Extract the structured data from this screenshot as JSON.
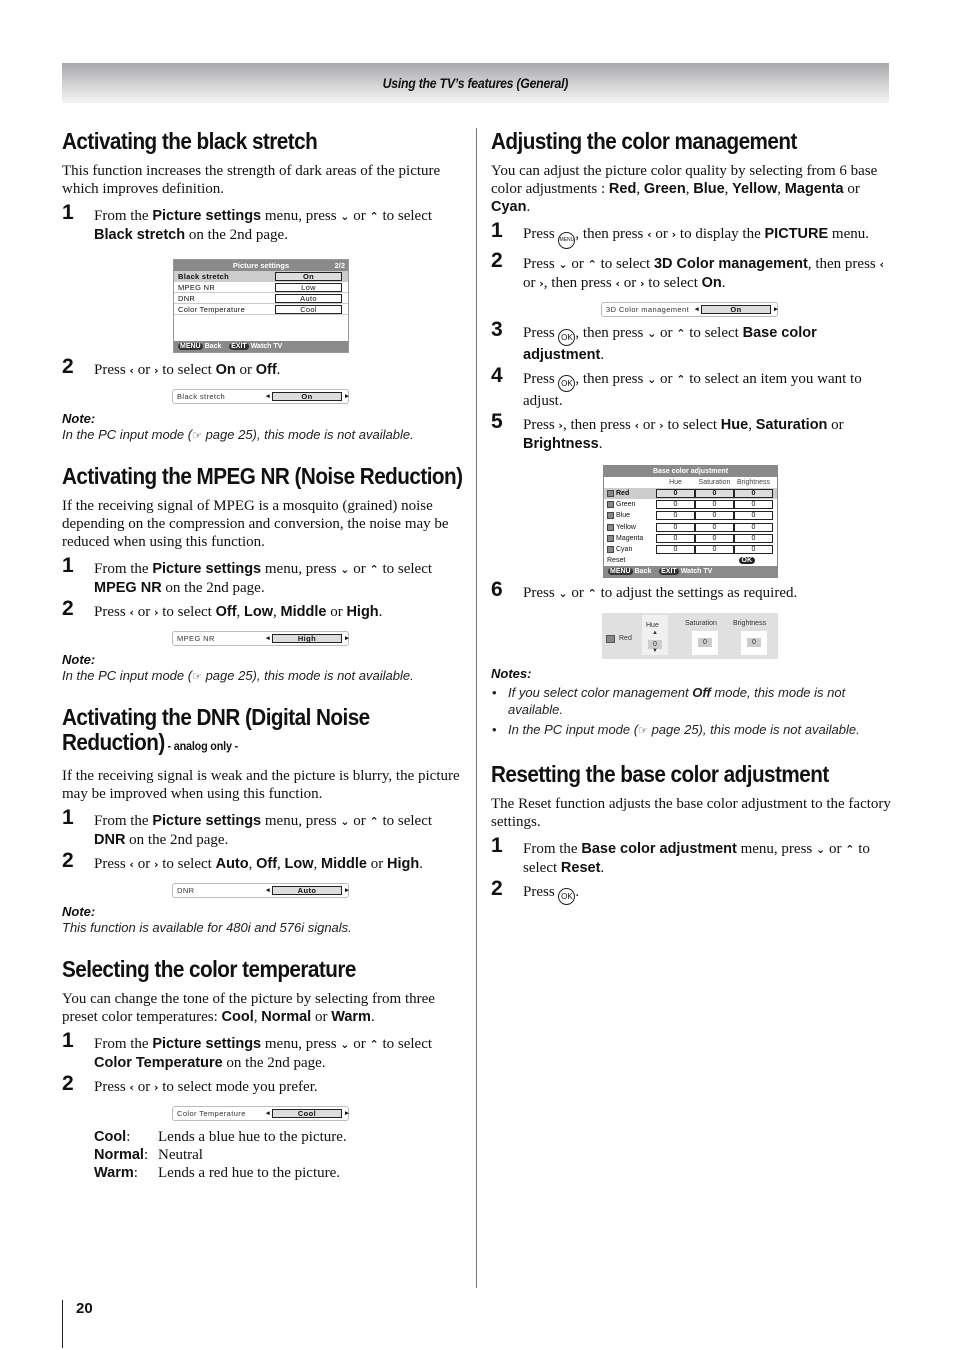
{
  "header": {
    "title": "Using the TV’s features (General)"
  },
  "page_number": "20",
  "left": {
    "black_stretch": {
      "title": "Activating the black stretch",
      "intro": "This function increases the strength of dark areas of the picture which improves definition.",
      "step1": {
        "num": "1",
        "a": "From the ",
        "b1": "Picture settings",
        "c": " menu, press ",
        "d": " or ",
        "e": " to select ",
        "b2": "Black stretch",
        "f": " on the 2nd page."
      },
      "menu": {
        "title": "Picture settings",
        "page": "2/2",
        "rows": [
          {
            "label": "Black stretch",
            "value": "On"
          },
          {
            "label": "MPEG NR",
            "value": "Low"
          },
          {
            "label": "DNR",
            "value": "Auto"
          },
          {
            "label": "Color Temperature",
            "value": "Cool"
          }
        ],
        "footer_back_key": "MENU",
        "footer_back": "Back",
        "footer_exit_key": "EXIT",
        "footer_exit": "Watch TV"
      },
      "step2": {
        "num": "2",
        "a": "Press ",
        "or": " or ",
        "c": " to select ",
        "b1": "On",
        "d": " or ",
        "b2": "Off",
        "e": "."
      },
      "bar": {
        "label": "Black stretch",
        "value": "On"
      },
      "note_title": "Note:",
      "note": {
        "a": "In the PC input mode (",
        "b": " page 25), this mode is not available."
      }
    },
    "mpeg": {
      "title": "Activating the MPEG NR (Noise Reduction)",
      "intro": "If the receiving signal of MPEG is a mosquito (grained) noise depending on the compression and conversion, the noise may be reduced when using this function.",
      "step1": {
        "num": "1",
        "a": "From the ",
        "b1": "Picture settings",
        "c": " menu, press ",
        "d": " or ",
        "e": "  to select ",
        "b2": "MPEG NR",
        "f": " on the 2nd page."
      },
      "step2": {
        "num": "2",
        "a": "Press ",
        "or": " or ",
        "c": " to select ",
        "opts": [
          "Off",
          "Low",
          "Middle",
          "High"
        ],
        "sep": ", ",
        "or2": " or ",
        "e": "."
      },
      "bar": {
        "label": "MPEG NR",
        "value": "High"
      },
      "note_title": "Note:",
      "note": {
        "a": "In the PC input mode (",
        "b": " page 25), this mode is not available."
      }
    },
    "dnr": {
      "title": "Activating the DNR (Digital Noise Reduction)",
      "suffix": " - analog only -",
      "intro": "If the receiving signal is weak and the picture is blurry, the picture may be improved when using this function.",
      "step1": {
        "num": "1",
        "a": "From the ",
        "b1": "Picture settings",
        "c": " menu, press ",
        "d": " or ",
        "e": " to select ",
        "b2": "DNR",
        "f": " on the 2nd page."
      },
      "step2": {
        "num": "2",
        "a": "Press ",
        "or": " or ",
        "c": " to select ",
        "opts": [
          "Auto",
          "Off",
          "Low",
          "Middle",
          "High"
        ],
        "sep": ", ",
        "or2": " or ",
        "e": "."
      },
      "bar": {
        "label": "DNR",
        "value": "Auto"
      },
      "note_title": "Note:",
      "note": "This function is available for 480i and 576i signals."
    },
    "color_temp": {
      "title": "Selecting the color temperature",
      "intro_a": "You can change the tone of the picture by selecting from three preset color temperatures: ",
      "opts": [
        "Cool",
        "Normal",
        "Warm"
      ],
      "step1": {
        "num": "1",
        "a": "From the ",
        "b1": "Picture settings",
        "c": " menu, press ",
        "d": " or ",
        "e": " to select ",
        "b2": "Color Temperature",
        "f": " on the 2nd page."
      },
      "step2": {
        "num": "2",
        "a": "Press ",
        "or": " or ",
        "c": " to select mode you prefer."
      },
      "bar": {
        "label": "Color Temperature",
        "value": "Cool"
      },
      "defs": [
        {
          "k": "Cool",
          "v": "Lends a blue hue to the picture."
        },
        {
          "k": "Normal",
          "v": "Neutral"
        },
        {
          "k": "Warm",
          "v": "Lends a red hue to the picture."
        }
      ]
    }
  },
  "right": {
    "color_mgmt": {
      "title": "Adjusting the color management",
      "intro_a": "You can adjust the picture color quality by selecting from 6 base color adjustments : ",
      "colors": [
        "Red",
        "Green",
        "Blue",
        "Yellow",
        "Magenta",
        "Cyan"
      ],
      "step1": {
        "num": "1",
        "a": "Press ",
        "menu_key": "MENU",
        "b": ", then press ",
        "or": " or ",
        "c": " to display the ",
        "b1": "PICTURE",
        "d": " menu."
      },
      "step2": {
        "num": "2",
        "a": "Press ",
        "or": " or ",
        "b": " to select ",
        "b1": "3D Color management",
        "c": ", then press ",
        "d": ", then press ",
        "e": " to select ",
        "b2": "On",
        "f": "."
      },
      "bar": {
        "label": "3D Color management",
        "value": "On"
      },
      "step3": {
        "num": "3",
        "a": "Press ",
        "ok": "OK",
        "b": ", then press ",
        "or": " or ",
        "c": " to select ",
        "b1": "Base color adjustment",
        "d": "."
      },
      "step4": {
        "num": "4",
        "a": "Press ",
        "ok": "OK",
        "b": ", then press ",
        "or": " or ",
        "c": " to select an item you want to adjust."
      },
      "step5": {
        "num": "5",
        "a": "Press ",
        "b": ", then press ",
        "or": " or ",
        "c": " to select ",
        "b1": "Hue",
        "sep": ", ",
        "b2": "Saturation",
        "or2": " or ",
        "b3": "Brightness",
        "d": "."
      },
      "table": {
        "title": "Base color adjustment",
        "columns": [
          "Hue",
          "Saturation",
          "Brightness"
        ],
        "rows": [
          {
            "name": "Red",
            "values": [
              "0",
              "0",
              "0"
            ]
          },
          {
            "name": "Green",
            "values": [
              "0",
              "0",
              "0"
            ]
          },
          {
            "name": "Blue",
            "values": [
              "0",
              "0",
              "0"
            ]
          },
          {
            "name": "Yellow",
            "values": [
              "0",
              "0",
              "0"
            ]
          },
          {
            "name": "Magenta",
            "values": [
              "0",
              "0",
              "0"
            ]
          },
          {
            "name": "Cyan",
            "values": [
              "0",
              "0",
              "0"
            ]
          }
        ],
        "reset": "Reset",
        "ok": "OK",
        "footer_back_key": "MENU",
        "footer_back": "Back",
        "footer_exit_key": "EXIT",
        "footer_exit": "Watch TV"
      },
      "step6": {
        "num": "6",
        "a": "Press ",
        "or": " or ",
        "c": " to adjust the settings as required."
      },
      "adjust": {
        "color": "Red",
        "labels": [
          "Hue",
          "Saturation",
          "Brightness"
        ],
        "values": [
          "0",
          "0",
          "0"
        ]
      },
      "notes_title": "Notes:",
      "note1": {
        "a": "If you select color management ",
        "b": "Off",
        "c": " mode, this mode is not available."
      },
      "note2": {
        "a": "In the PC input mode (",
        "b": " page 25), this mode is not available."
      }
    },
    "reset": {
      "title": "Resetting the base color adjustment",
      "intro": "The Reset function adjusts the base color adjustment to the factory settings.",
      "step1": {
        "num": "1",
        "a": "From the ",
        "b1": "Base color adjustment",
        "c": " menu, press ",
        "d": " or ",
        "e": " to select ",
        "b2": "Reset",
        "f": "."
      },
      "step2": {
        "num": "2",
        "a": "Press ",
        "ok": "OK",
        "b": "."
      }
    }
  },
  "icons": {
    "down": "⌄",
    "up": "⌃",
    "left": "‹",
    "right": "›",
    "hand": "☞"
  }
}
